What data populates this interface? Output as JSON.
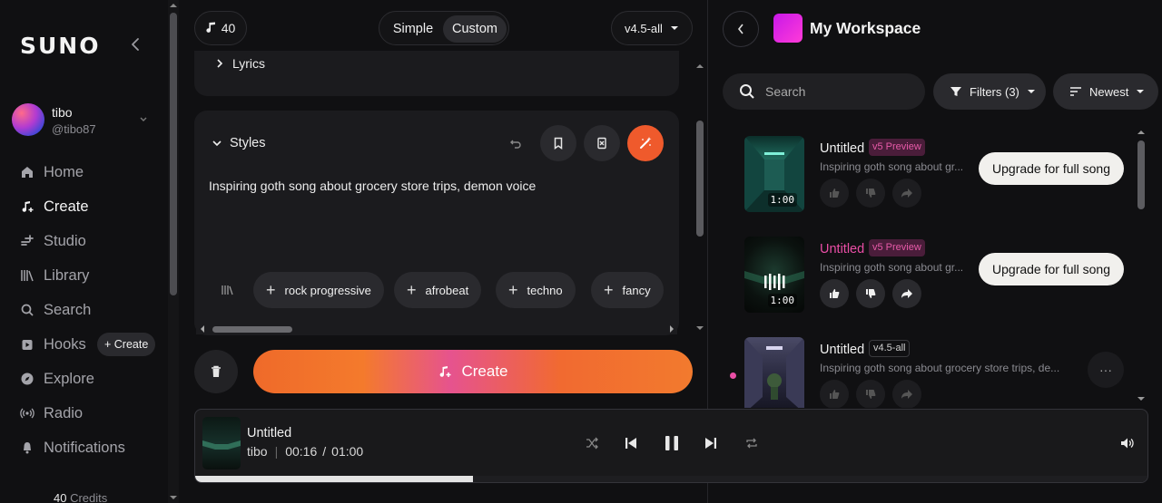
{
  "sidebar": {
    "logo": "SUNO",
    "user": {
      "name": "tibo",
      "handle": "@tibo87"
    },
    "nav": [
      {
        "label": "Home",
        "icon": "home-icon"
      },
      {
        "label": "Create",
        "icon": "music-note-plus-icon"
      },
      {
        "label": "Studio",
        "icon": "studio-icon"
      },
      {
        "label": "Library",
        "icon": "library-icon"
      },
      {
        "label": "Search",
        "icon": "search-icon"
      },
      {
        "label": "Hooks",
        "icon": "hooks-icon"
      },
      {
        "label": "Explore",
        "icon": "compass-icon"
      },
      {
        "label": "Radio",
        "icon": "radio-icon"
      },
      {
        "label": "Notifications",
        "icon": "bell-icon"
      }
    ],
    "hooks_create": "+ Create",
    "credits_value": "40",
    "credits_label": "Credits"
  },
  "create_panel": {
    "credits_badge": "40",
    "mode_simple": "Simple",
    "mode_custom": "Custom",
    "model": "v4.5-all",
    "lyrics_label": "Lyrics",
    "styles_label": "Styles",
    "styles_text": "Inspiring goth song about grocery store trips, demon voice",
    "tags": [
      "rock progressive",
      "afrobeat",
      "techno",
      "fancy"
    ],
    "create_label": "Create"
  },
  "workspace": {
    "title": "My Workspace",
    "search_placeholder": "Search",
    "filters_label": "Filters (3)",
    "sort_label": "Newest",
    "songs": [
      {
        "title": "Untitled",
        "badge": "v5 Preview",
        "desc": "Inspiring goth song about gr...",
        "duration": "1:00",
        "action": "Upgrade for full song"
      },
      {
        "title": "Untitled",
        "badge": "v5 Preview",
        "desc": "Inspiring goth song about gr...",
        "duration": "1:00",
        "action": "Upgrade for full song"
      },
      {
        "title": "Untitled",
        "badge": "v4.5-all",
        "desc": "Inspiring goth song about grocery store trips, de...",
        "action": "···"
      }
    ]
  },
  "player": {
    "title": "Untitled",
    "artist": "tibo",
    "current_time": "00:16",
    "separator": "/",
    "total_time": "01:00",
    "progress_fraction": 0.291
  },
  "colors": {
    "accent_orange": "#ef6a2a",
    "accent_pink": "#ea4ea6",
    "background": "#101012"
  }
}
